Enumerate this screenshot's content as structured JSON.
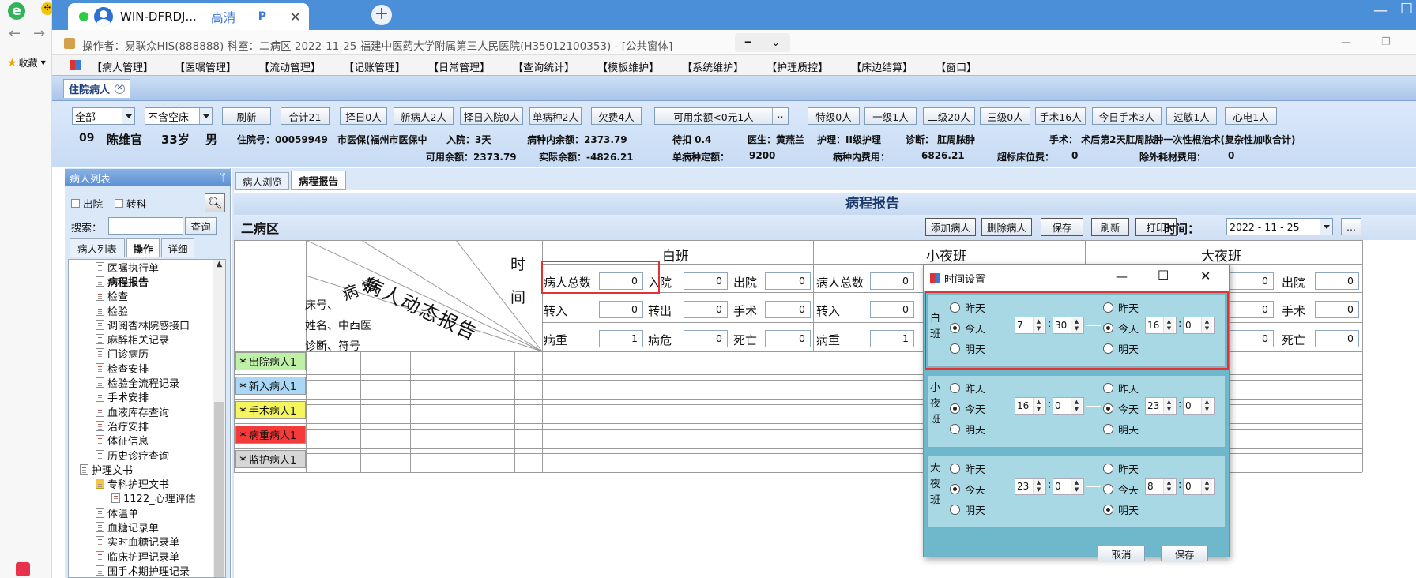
{
  "browser": {
    "tab_title": "WIN-DFRDJ...",
    "tab_quality": "高清",
    "tab_p": "P",
    "close": "✕",
    "new_tab": "+",
    "back": "←",
    "forward": "→",
    "favorites": "收藏",
    "minimize": "—",
    "restore": "☐"
  },
  "app": {
    "title_bar": "操作者：易联众HIS(888888) 科室：二病区 2022-11-25 福建中医药大学附属第三人民医院(H35012100353) - [公共窗体]",
    "menu": [
      "【病人管理】",
      "【医嘱管理】",
      "【流动管理】",
      "【记账管理】",
      "【日常管理】",
      "【查询统计】",
      "【模板维护】",
      "【系统维护】",
      "【护理质控】",
      "【床边结算】",
      "【窗口】"
    ],
    "doc_tab": "住院病人"
  },
  "toolbar": {
    "sel1": "全部",
    "sel2": "不含空床",
    "buttons": [
      "刷新",
      "合计21",
      "择日0人",
      "新病人2人",
      "择日入院0人",
      "单病种2人",
      "欠费4人"
    ],
    "avail_btn": "可用余额<0元1人",
    "avail_more": "..",
    "buttons2": [
      "特级0人",
      "一级1人",
      "二级20人",
      "三级0人",
      "手术16人",
      "今日手术3人",
      "过敏1人",
      "心电1人"
    ]
  },
  "patient": {
    "bed": "09",
    "name": "陈维官",
    "age": "33岁",
    "sex": "男",
    "inpatient_no": "住院号：00059949",
    "insurance": "市医保(福州市医保中",
    "admit": "入院：3天",
    "disease_balance": "病种内余额：2373.79",
    "withhold": "待扣 0.4",
    "doctor": "医生：黄燕兰",
    "nursing": "护理：II级护理",
    "diagnosis": "诊断： 肛周脓肿",
    "surgery": "手术： 术后第2天肛周脓肿一次性根治术(复杂性加收合计)",
    "avail_balance": "可用余额：2373.79",
    "actual_balance": "实际余额：-4826.21",
    "single_quota_label": "单病种定额：",
    "single_quota": "9200",
    "disease_fee_label": "病种内费用：",
    "disease_fee": "6826.21",
    "over_bed_label": "超标床位费：",
    "over_bed": "0",
    "excl_fee_label": "除外耗材费用：",
    "excl_fee": "0"
  },
  "left_panel": {
    "title": "病人列表",
    "pin": "ᛘ",
    "cb_discharge": "出院",
    "cb_transfer": "转科",
    "search_label": "搜索：",
    "query_btn": "查询",
    "tabs": [
      "病人列表",
      "操作",
      "详细"
    ],
    "tree": [
      "医嘱执行单",
      "病程报告",
      "检查",
      "检验",
      "调阅杏林院感接口",
      "麻醉相关记录",
      "门诊病历",
      "检查安排",
      "检验全流程记录",
      "手术安排",
      "血液库存查询",
      "治疗安排",
      "体征信息",
      "历史诊疗查询",
      "护理文书",
      "专科护理文书",
      "1122_心理评估",
      "体温单",
      "血糖记录单",
      "实时血糖记录单",
      "临床护理记录单",
      "围手术期护理记录"
    ]
  },
  "content": {
    "tabs": [
      "病人浏览",
      "病程报告"
    ],
    "report_title": "病程报告",
    "ward": "二病区",
    "actions": [
      "添加病人",
      "删除病人",
      "保存",
      "刷新",
      "打印"
    ],
    "time_label": "时间：",
    "date_value": "2022 - 11 - 25",
    "more": "...",
    "diag_title": "病人动态报告",
    "diag_condition": "病 情",
    "diag_time1": "时",
    "diag_time2": "间",
    "diag_bed": "床号、",
    "diag_name": "姓名、中西医",
    "diag_diag": "诊断、符号",
    "shifts": [
      "白班",
      "小夜班",
      "大夜班"
    ],
    "stat_labels": {
      "total": "病人总数",
      "in": "入院",
      "out": "出院",
      "transin": "转入",
      "transout": "转出",
      "surgery": "手术",
      "serious": "病重",
      "critical": "病危",
      "death": "死亡"
    },
    "day": {
      "total": "0",
      "in": "0",
      "out": "0",
      "transin": "0",
      "transout": "0",
      "surgery": "0",
      "serious": "1",
      "critical": "0",
      "death": "0"
    },
    "small": {
      "total": "0",
      "transin": "0",
      "serious": "1"
    },
    "big": {
      "out": "0",
      "surgery": "0",
      "death": "0",
      "in": "0",
      "transout": "0",
      "critical": "0"
    },
    "rows": [
      "出院病人1",
      "新入病人1",
      "手术病人1",
      "病重病人1",
      "监护病人1"
    ],
    "row_colors": [
      "#bff0a8",
      "#a9d7f5",
      "#f5f560",
      "#f53a3a",
      "#d6d6d6"
    ]
  },
  "dialog": {
    "title": "时间设置",
    "minimize": "—",
    "maximize": "☐",
    "close": "✕",
    "day_options": [
      "昨天",
      "今天",
      "明天"
    ],
    "sections": [
      {
        "label": "白班",
        "from_day": 1,
        "from_h": "7",
        "from_m": "30",
        "to_day": 1,
        "to_h": "16",
        "to_m": "0"
      },
      {
        "label": "小夜班",
        "from_day": 1,
        "from_h": "16",
        "from_m": "0",
        "to_day": 1,
        "to_h": "23",
        "to_m": "0"
      },
      {
        "label": "大夜班",
        "from_day": 1,
        "from_h": "23",
        "from_m": "0",
        "to_day": 2,
        "to_h": "8",
        "to_m": "0"
      }
    ],
    "colon": ":",
    "cancel": "取消",
    "save": "保存"
  }
}
